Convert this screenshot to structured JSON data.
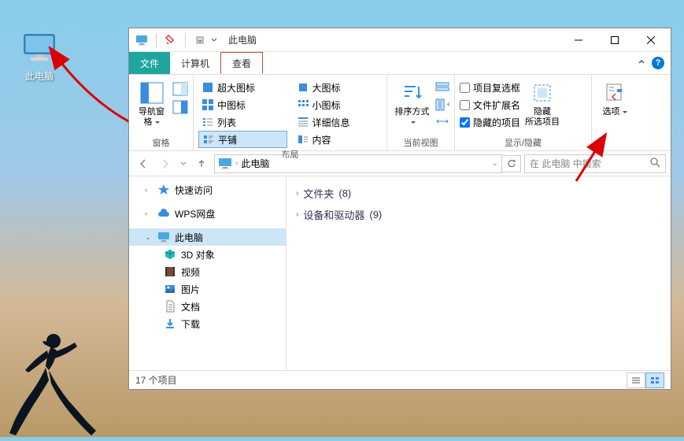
{
  "desktop": {
    "this_pc_label": "此电脑"
  },
  "window": {
    "title": "此电脑",
    "tabs": {
      "file": "文件",
      "computer": "计算机",
      "view": "查看"
    },
    "ribbon": {
      "panes_group": {
        "nav_pane": "导航窗格",
        "label": "窗格"
      },
      "layout_group": {
        "extra_large": "超大图标",
        "large": "大图标",
        "medium": "中图标",
        "small": "小图标",
        "list": "列表",
        "details": "详细信息",
        "tiles": "平铺",
        "content": "内容",
        "label": "布局"
      },
      "view_group": {
        "sort_by": "排序方式",
        "label": "当前视图"
      },
      "showhide_group": {
        "item_checkboxes": "项目复选框",
        "file_ext": "文件扩展名",
        "hidden_items": "隐藏的项目",
        "hide_selected_top": "隐藏",
        "hide_selected_bottom": "所选项目",
        "label": "显示/隐藏"
      },
      "options_group": {
        "options": "选项"
      }
    },
    "address": {
      "crumb": "此电脑",
      "refresh_dropdown": "▼"
    },
    "search": {
      "placeholder": "在 此电脑 中搜索"
    },
    "nav": {
      "quick_access": "快速访问",
      "wps": "WPS网盘",
      "this_pc": "此电脑",
      "children": {
        "objects3d": "3D 对象",
        "videos": "视频",
        "pictures": "图片",
        "documents": "文档",
        "downloads": "下载"
      }
    },
    "content": {
      "folders": {
        "label": "文件夹",
        "count": "(8)"
      },
      "devices": {
        "label": "设备和驱动器",
        "count": "(9)"
      }
    },
    "status": {
      "item_count": "17 个项目"
    }
  }
}
